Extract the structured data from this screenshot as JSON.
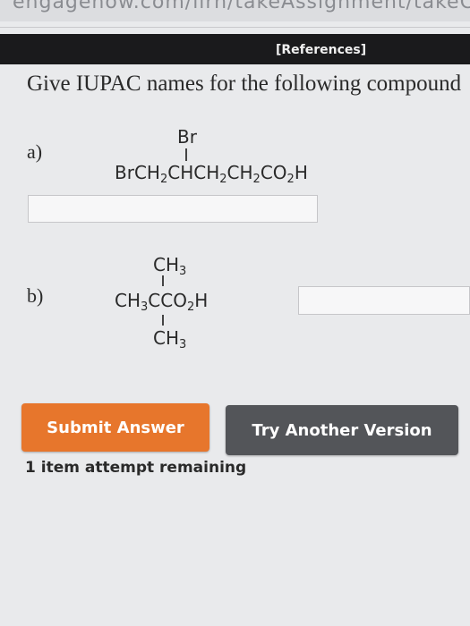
{
  "browser": {
    "url_fragment": "engagenow.com/ilrn/takeAssignment/takeCovalent"
  },
  "header": {
    "references_label": "[References]"
  },
  "question": {
    "prompt": "Give IUPAC names for the following compound"
  },
  "parts": [
    {
      "label": "a)",
      "substituent": "Br",
      "formula": {
        "t1": "BrCH",
        "s1": "2",
        "t2": "CHCH",
        "s2": "2",
        "t3": "CH",
        "s3": "2",
        "t4": "CO",
        "s4": "2",
        "t5": "H"
      },
      "answer": {
        "value": "",
        "placeholder": ""
      }
    },
    {
      "label": "b)",
      "top": {
        "t1": "CH",
        "s1": "3"
      },
      "main": {
        "t1": "CH",
        "s1": "3",
        "t2": "CCO",
        "s2": "2",
        "t3": "H"
      },
      "bottom": {
        "t1": "CH",
        "s1": "3"
      },
      "answer": {
        "value": "",
        "placeholder": ""
      }
    }
  ],
  "actions": {
    "submit_label": "Submit Answer",
    "try_another_label": "Try Another Version"
  },
  "status": {
    "attempts_text": "1 item attempt remaining"
  },
  "colors": {
    "submit": "#e7762c",
    "try_another": "#535559",
    "topbar": "#1a1a1c"
  }
}
